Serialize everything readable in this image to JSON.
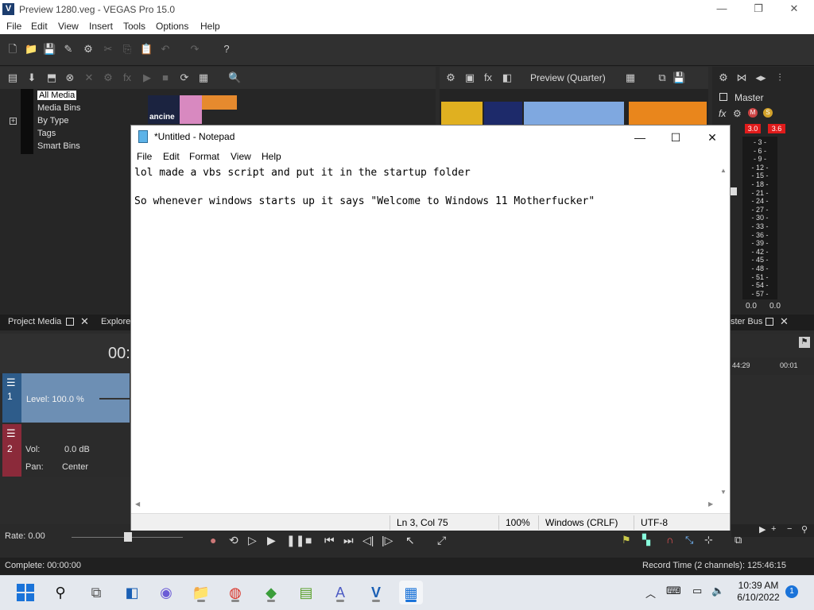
{
  "vegas": {
    "title": "Preview 1280.veg - VEGAS Pro 15.0",
    "logo_letter": "V",
    "menu": [
      "File",
      "Edit",
      "View",
      "Insert",
      "Tools",
      "Options",
      "Help"
    ],
    "media_tree": [
      "All Media",
      "Media Bins",
      "By Type",
      "Tags",
      "Smart Bins"
    ],
    "thumb_caption": "ancine",
    "preview_label": "Preview (Quarter)",
    "master_label": "Master",
    "meter_peaks": [
      "3.0",
      "3.6"
    ],
    "meter_ticks": [
      "3",
      "6",
      "9",
      "12",
      "15",
      "18",
      "21",
      "24",
      "27",
      "30",
      "33",
      "36",
      "39",
      "42",
      "45",
      "48",
      "51",
      "54",
      "57"
    ],
    "meter_bottom": [
      "0.0",
      "0.0"
    ],
    "tabs": {
      "project_media": "Project Media",
      "explorer": "Explore",
      "master_bus": "ster Bus"
    },
    "timecode": "00:",
    "ruler": [
      "44:29",
      "00:01"
    ],
    "track1": {
      "number": "1",
      "level": "Level: 100.0 %"
    },
    "track2": {
      "number": "2",
      "vol_label": "Vol:",
      "vol_value": "0.0 dB",
      "pan_label": "Pan:",
      "pan_value": "Center"
    },
    "rate": "Rate: 0.00",
    "status_left": "Complete: 00:00:00",
    "status_right": "Record Time (2 channels): 125:46:15",
    "colors": {
      "accent": "#1c3d6e",
      "meter_peak": "#e01b1b",
      "track1": "#6d8fb4",
      "track2": "#8b2a3a"
    }
  },
  "notepad": {
    "title": "*Untitled - Notepad",
    "menu": [
      "File",
      "Edit",
      "Format",
      "View",
      "Help"
    ],
    "line1": "lol made a vbs script and put it in the startup folder",
    "line2": "",
    "line3": "So whenever windows starts up it says \"Welcome to Windows 11 Motherfucker\"",
    "status": {
      "position": "Ln 3, Col 75",
      "zoom": "100%",
      "eol": "Windows (CRLF)",
      "encoding": "UTF-8"
    }
  },
  "taskbar": {
    "apps": [
      "start-icon",
      "search-icon",
      "task-view-icon",
      "widgets-icon",
      "teams-chat-icon",
      "file-explorer-icon",
      "chrome-icon",
      "bluestacks-icon",
      "notepadpp-icon",
      "app-a-icon",
      "vegas-icon",
      "notepad-icon"
    ],
    "time": "10:39 AM",
    "date": "6/10/2022",
    "notifications": "1"
  }
}
